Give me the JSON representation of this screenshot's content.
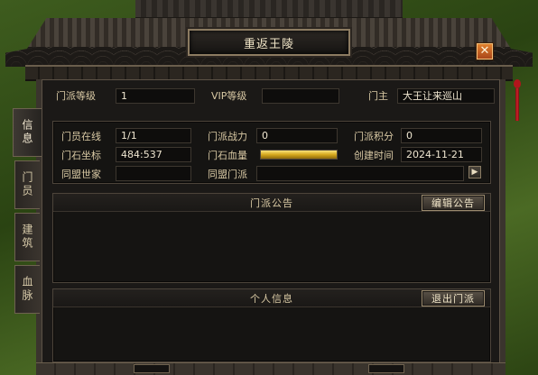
{
  "window": {
    "title": "重返王陵",
    "close_label": "✕"
  },
  "header": {
    "level_label": "门派等级",
    "level_value": "1",
    "vip_label": "VIP等级",
    "vip_value": "",
    "leader_label": "门主",
    "leader_value": "大王让来巡山"
  },
  "tabs": [
    {
      "label": "信息",
      "active": true
    },
    {
      "label": "门员",
      "active": false
    },
    {
      "label": "建筑",
      "active": false
    },
    {
      "label": "血脉",
      "active": false
    }
  ],
  "info": {
    "online_label": "门员在线",
    "online_value": "1/1",
    "power_label": "门派战力",
    "power_value": "0",
    "points_label": "门派积分",
    "points_value": "0",
    "coords_label": "门石坐标",
    "coords_value": "484:537",
    "hp_label": "门石血量",
    "hp_fraction": 1.0,
    "created_label": "创建时间",
    "created_value": "2024-11-21",
    "alliance_family_label": "同盟世家",
    "alliance_family_value": "",
    "alliance_sect_label": "同盟门派",
    "alliance_sect_value": "",
    "more_icon": "▶"
  },
  "announcement": {
    "title": "门派公告",
    "edit_button": "编辑公告",
    "content": ""
  },
  "personal": {
    "title": "个人信息",
    "quit_button": "退出门派",
    "content": ""
  },
  "colors": {
    "panel_bg": "#1b1917",
    "label_text": "#d9c9a4",
    "hp_bar": "#e2b52a",
    "close_button": "#d06a26",
    "tassel": "#b2151c"
  }
}
